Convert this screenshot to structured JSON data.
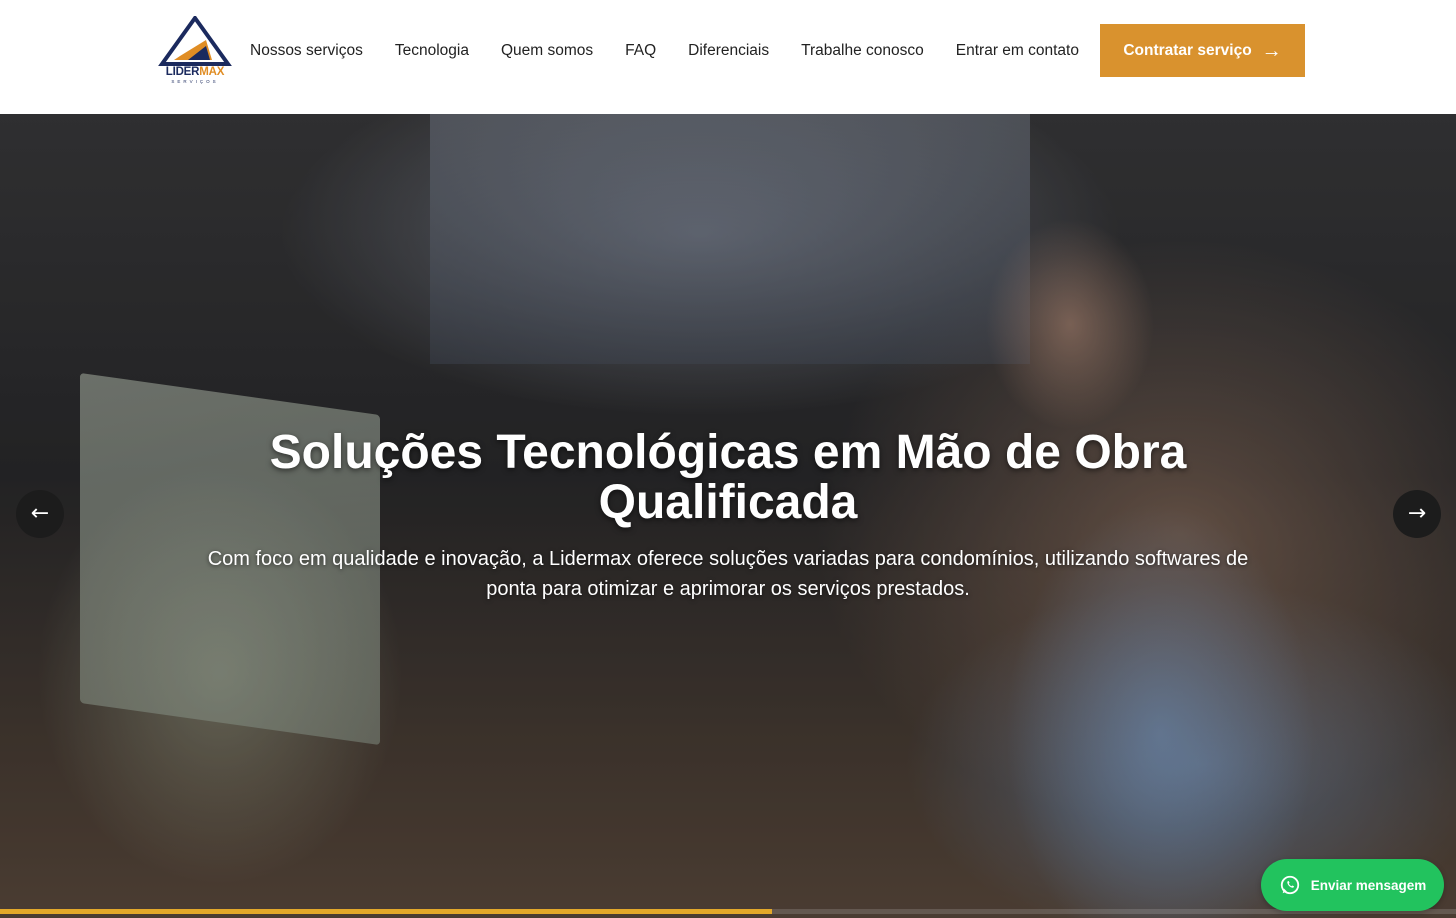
{
  "brand": {
    "name_part1": "LIDER",
    "name_part2": "MAX",
    "tagline": "SERVIÇOS",
    "colors": {
      "navy": "#1b2a5e",
      "orange": "#e08d24"
    }
  },
  "nav": {
    "items": [
      {
        "label": "Nossos serviços"
      },
      {
        "label": "Tecnologia"
      },
      {
        "label": "Quem somos"
      },
      {
        "label": "FAQ"
      },
      {
        "label": "Diferenciais"
      },
      {
        "label": "Trabalhe conosco"
      },
      {
        "label": "Entrar em contato"
      }
    ],
    "cta_label": "Contratar serviço",
    "cta_icon": "arrow-right-icon",
    "cta_color": "#d9922e"
  },
  "hero": {
    "title_line1": "Soluções Tecnológicas em Mão de Obra",
    "title_line2": "Qualificada",
    "subtitle_line1": "Com foco em qualidade e inovação, a Lidermax oferece soluções variadas para condomínios, utilizando softwares de",
    "subtitle_line2": "ponta para otimizar e aprimorar os serviços prestados.",
    "prev_icon": "arrow-left-icon",
    "next_icon": "arrow-right-icon",
    "progress_fraction": 0.53,
    "progress_color": "#e3a82a"
  },
  "whatsapp": {
    "label": "Enviar mensagem",
    "icon": "whatsapp-icon",
    "color": "#22c35e"
  }
}
